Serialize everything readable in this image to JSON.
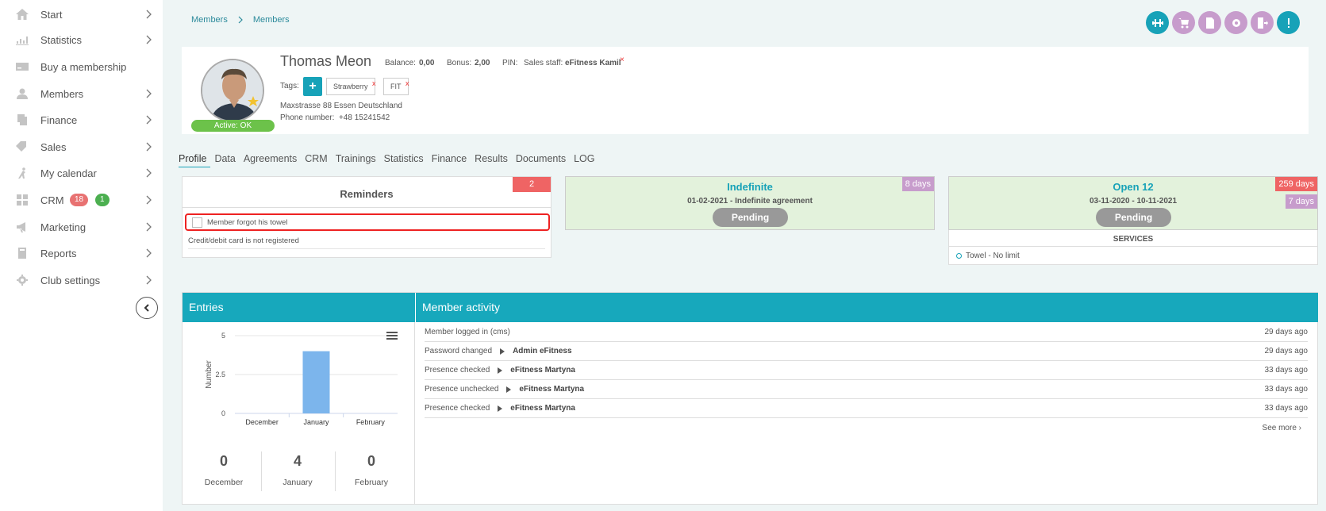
{
  "sidebar": {
    "items": [
      {
        "label": "Start",
        "icon": "home-icon"
      },
      {
        "label": "Statistics",
        "icon": "chart-icon"
      },
      {
        "label": "Buy a membership",
        "icon": "card-icon"
      },
      {
        "label": "Members",
        "icon": "user-icon"
      },
      {
        "label": "Finance",
        "icon": "finance-icon"
      },
      {
        "label": "Sales",
        "icon": "tag-icon"
      },
      {
        "label": "My calendar",
        "icon": "runner-icon"
      },
      {
        "label": "CRM",
        "icon": "grid-icon",
        "badge_red": "18",
        "badge_green": "1"
      },
      {
        "label": "Marketing",
        "icon": "megaphone-icon"
      },
      {
        "label": "Reports",
        "icon": "book-icon"
      },
      {
        "label": "Club settings",
        "icon": "gear-icon"
      }
    ]
  },
  "breadcrumb": [
    "Members",
    "Members"
  ],
  "colors": {
    "accent": "#17a8bc",
    "action_teal": "#17a2b8",
    "action_purple": "#c79ccc",
    "active_green": "#6cc24a",
    "danger": "#ef6464"
  },
  "profile": {
    "name": "Thomas Meon",
    "balance_label": "Balance:",
    "balance": "0,00",
    "bonus_label": "Bonus:",
    "bonus": "2,00",
    "pin_label": "PIN:",
    "sales_staff_label": "Sales staff:",
    "sales_staff": "eFitness Kamil",
    "status": "Active: OK",
    "tags_label": "Tags:",
    "tags": [
      "Strawberry",
      "FIT"
    ],
    "address": "Maxstrasse 88 Essen Deutschland",
    "phone_label": "Phone number:",
    "phone": "+48 15241542"
  },
  "tabs": [
    "Profile",
    "Data",
    "Agreements",
    "CRM",
    "Trainings",
    "Statistics",
    "Finance",
    "Results",
    "Documents",
    "LOG"
  ],
  "reminders": {
    "title": "Reminders",
    "count": "2",
    "items": [
      "Member forgot his towel"
    ],
    "note": "Credit/debit card is not registered"
  },
  "agreements": [
    {
      "title": "Indefinite",
      "dates": "01-02-2021 - Indefinite agreement",
      "status": "Pending",
      "days": [
        "8 days"
      ]
    },
    {
      "title": "Open 12",
      "dates": "03-11-2020 - 10-11-2021",
      "status": "Pending",
      "days": [
        "259 days",
        "7 days"
      ],
      "services_title": "SERVICES",
      "services": [
        "Towel - No limit"
      ]
    }
  ],
  "entries": {
    "title": "Entries",
    "stats": [
      {
        "value": "0",
        "label": "December"
      },
      {
        "value": "4",
        "label": "January"
      },
      {
        "value": "0",
        "label": "February"
      }
    ]
  },
  "chart_data": {
    "type": "bar",
    "categories": [
      "December",
      "January",
      "February"
    ],
    "values": [
      0,
      4,
      0
    ],
    "ylabel": "Number",
    "ylim": [
      0,
      5
    ],
    "yticks": [
      "0",
      "2.5",
      "5"
    ],
    "grid": true
  },
  "activity": {
    "title": "Member activity",
    "rows": [
      {
        "text": "Member logged in (cms)",
        "who": "",
        "time": "29 days ago"
      },
      {
        "text": "Password changed",
        "who": "Admin eFitness",
        "time": "29 days ago"
      },
      {
        "text": "Presence checked",
        "who": "eFitness Martyna",
        "time": "33 days ago"
      },
      {
        "text": "Presence unchecked",
        "who": "eFitness Martyna",
        "time": "33 days ago"
      },
      {
        "text": "Presence checked",
        "who": "eFitness Martyna",
        "time": "33 days ago"
      }
    ],
    "see_more": "See more ›"
  }
}
